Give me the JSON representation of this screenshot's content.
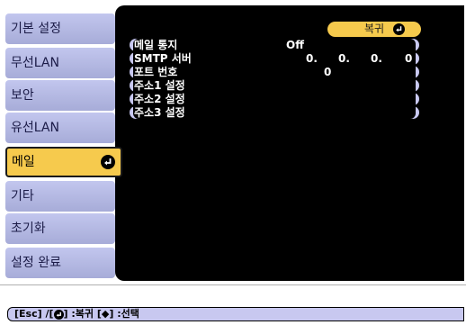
{
  "menu": {
    "items": [
      {
        "label": "기본 설정"
      },
      {
        "label": "무선LAN"
      },
      {
        "label": "보안"
      },
      {
        "label": "유선LAN"
      },
      {
        "label": "메일",
        "selected": true
      },
      {
        "label": "기타"
      },
      {
        "label": "초기화"
      },
      {
        "label": "설정 완료"
      }
    ]
  },
  "panel": {
    "back_label": "복귀",
    "rows": [
      {
        "label": "메일 통지",
        "value": "Off"
      },
      {
        "label": "SMTP 서버",
        "value_parts": [
          "0.",
          "0.",
          "0.",
          "0"
        ]
      },
      {
        "label": "포트 번호",
        "value": "0"
      },
      {
        "label": "주소1 설정"
      },
      {
        "label": "주소2 설정"
      },
      {
        "label": "주소3 설정"
      }
    ]
  },
  "hint": {
    "esc": "[Esc] /[",
    "back": "] :복귀 [",
    "arrows": "◆",
    "select": "] :선택"
  },
  "colors": {
    "menu_item": "#b4b8e4",
    "menu_selected": "#f6ca4d",
    "panel": "#000000",
    "row": "#c8c8f0"
  },
  "icons": {
    "enter": "enter-icon",
    "updown": "up-down-arrows-icon"
  }
}
